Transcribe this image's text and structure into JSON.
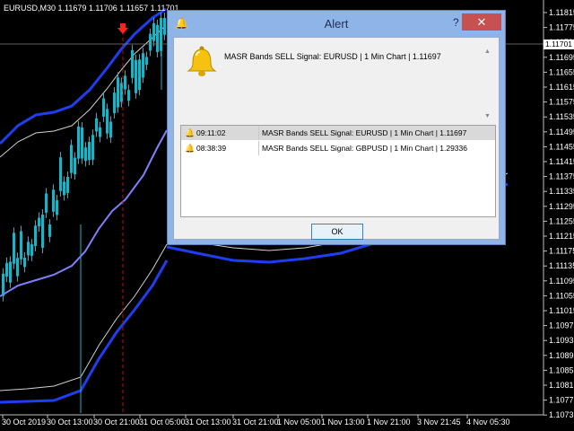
{
  "chart": {
    "symbol_label": "EURUSD,M30  1.11679 1.11706 1.11657 1.11701",
    "current_price": "1.11701",
    "price_ticks": [
      "1.11815",
      "1.11775",
      "1.11735",
      "1.11695",
      "1.11655",
      "1.11615",
      "1.11575",
      "1.11535",
      "1.11495",
      "1.11455",
      "1.11415",
      "1.11375",
      "1.11335",
      "1.11295",
      "1.11255",
      "1.11215",
      "1.11175",
      "1.11135",
      "1.11095",
      "1.11055",
      "1.11015",
      "1.10975",
      "1.10935",
      "1.10895",
      "1.10855",
      "1.10815",
      "1.10775",
      "1.10735"
    ],
    "time_ticks": [
      "30 Oct 2019",
      "30 Oct 13:00",
      "30 Oct 21:00",
      "31 Oct 05:00",
      "31 Oct 13:00",
      "31 Oct 21:00",
      "1 Nov 05:00",
      "1 Nov 13:00",
      "1 Nov 21:00",
      "3 Nov 21:45",
      "4 Nov 05:30"
    ],
    "colors": {
      "background": "#000000",
      "candles": "#19b4c8",
      "upper_band": "#1f3ef0",
      "middle_band": "#8080ff",
      "outer_band": "#d0d0d0",
      "signal_arrow": "#ff2020",
      "signal_line": "#c01010"
    }
  },
  "dialog": {
    "title": "Alert",
    "help_label": "?",
    "close_label": "✕",
    "message": "MASR Bands SELL Signal: EURUSD | 1 Min Chart | 1.11697",
    "ok_label": "OK",
    "alerts": [
      {
        "time": "09:11:02",
        "message": "MASR Bands SELL Signal: EURUSD | 1 Min Chart | 1.11697",
        "selected": true
      },
      {
        "time": "08:38:39",
        "message": "MASR Bands SELL Signal: GBPUSD | 1 Min Chart | 1.29336",
        "selected": false
      }
    ]
  }
}
